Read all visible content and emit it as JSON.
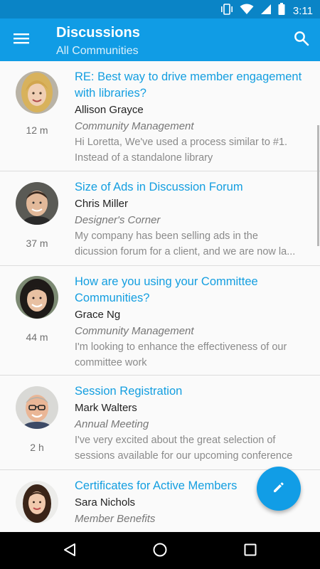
{
  "status_bar": {
    "time": "3:11",
    "icons": [
      "vibrate-icon",
      "wifi-icon",
      "cellular-signal-icon",
      "battery-icon"
    ]
  },
  "app_bar": {
    "title": "Discussions",
    "subtitle": "All Communities",
    "menu_icon": "hamburger-menu-icon",
    "search_icon": "search-icon",
    "color": "#109ce5"
  },
  "discussions": [
    {
      "title": "RE: Best way to drive member engagement with libraries?",
      "author": "Allison Grayce",
      "time": "12 m",
      "community": "Community Management",
      "snippet": [
        "Hi Loretta, We've used a process similar to #1.",
        "Instead of a standalone library"
      ]
    },
    {
      "title": "Size of Ads in Discussion Forum",
      "author": "Chris Miller",
      "time": "37 m",
      "community": "Designer's Corner",
      "snippet": [
        "My company has been selling ads in the",
        "dicussion forum for a client, and we are now la..."
      ]
    },
    {
      "title": "How are you using your Committee Communities?",
      "author": "Grace Ng",
      "time": "44 m",
      "community": "Community Management",
      "snippet": [
        "I'm looking to enhance the effectiveness of our",
        "committee work"
      ]
    },
    {
      "title": "Session Registration",
      "author": "Mark Walters",
      "time": "2 h",
      "community": "Annual Meeting",
      "snippet": [
        "I've very excited about the great selection of",
        "sessions available for our upcoming conference"
      ]
    },
    {
      "title": "Certificates for Active Members",
      "author": "Sara Nichols",
      "time": "",
      "community": "Member Benefits",
      "snippet": []
    }
  ],
  "fab": {
    "icon": "pencil-icon",
    "color": "#119de6"
  },
  "nav_bar": {
    "icons": [
      "back-icon",
      "home-icon",
      "recent-apps-icon"
    ]
  },
  "colors": {
    "accent": "#139ee0",
    "status_bar": "#0a84c6"
  }
}
